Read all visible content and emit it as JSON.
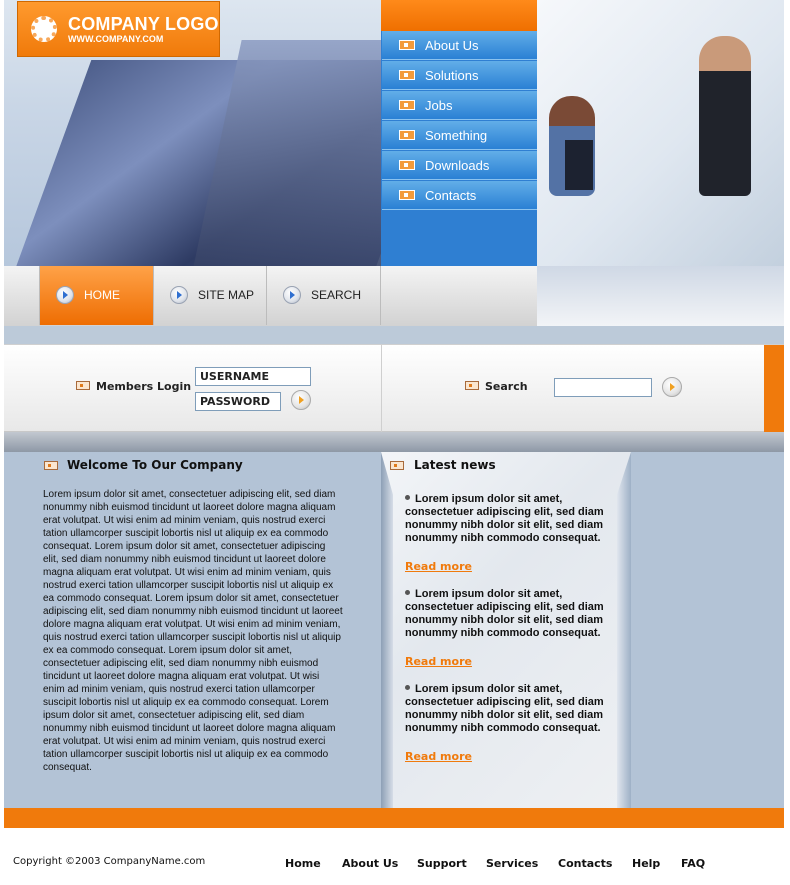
{
  "header": {
    "logo_title": "COMPANY LOGO",
    "logo_url": "WWW.COMPANY.COM"
  },
  "side_nav": [
    {
      "label": "About Us"
    },
    {
      "label": "Solutions"
    },
    {
      "label": "Jobs"
    },
    {
      "label": "Something"
    },
    {
      "label": "Downloads"
    },
    {
      "label": "Contacts"
    }
  ],
  "tabs": [
    {
      "label": "HOME",
      "active": true
    },
    {
      "label": "SITE MAP",
      "active": false
    },
    {
      "label": "SEARCH",
      "active": false
    }
  ],
  "login": {
    "label": "Members Login",
    "username_value": "USERNAME",
    "password_value": "PASSWORD"
  },
  "search": {
    "label": "Search",
    "value": ""
  },
  "welcome": {
    "title": "Welcome To Our Company",
    "body": "Lorem ipsum dolor sit amet, consectetuer adipiscing elit, sed diam nonummy nibh euismod tincidunt ut laoreet dolore magna aliquam erat volutpat. Ut wisi enim ad minim veniam, quis nostrud exerci tation ullamcorper suscipit lobortis nisl ut aliquip ex ea commodo consequat. Lorem ipsum dolor sit amet, consectetuer adipiscing elit, sed diam nonummy nibh euismod tincidunt ut laoreet dolore magna aliquam erat volutpat. Ut wisi enim ad minim veniam, quis nostrud exerci tation ullamcorper suscipit lobortis nisl ut aliquip ex ea commodo consequat. Lorem ipsum dolor sit amet, consectetuer adipiscing elit, sed diam nonummy nibh euismod tincidunt ut laoreet dolore magna aliquam erat volutpat. Ut wisi enim ad minim veniam, quis nostrud exerci tation ullamcorper suscipit lobortis nisl ut aliquip ex ea commodo consequat. Lorem ipsum dolor sit amet, consectetuer adipiscing elit, sed diam nonummy nibh euismod tincidunt ut laoreet dolore magna aliquam erat volutpat. Ut wisi enim ad minim veniam, quis nostrud exerci tation ullamcorper suscipit lobortis nisl ut aliquip ex ea commodo consequat. Lorem ipsum dolor sit amet, consectetuer adipiscing elit, sed diam nonummy nibh euismod tincidunt ut laoreet dolore magna aliquam erat volutpat. Ut wisi enim ad minim veniam, quis nostrud exerci tation ullamcorper suscipit lobortis nisl ut aliquip ex ea commodo consequat."
  },
  "news": {
    "title": "Latest news",
    "items": [
      {
        "text": "Lorem ipsum dolor sit amet, consectetuer adipiscing elit, sed diam nonummy nibh dolor sit elit, sed diam nonummy nibh commodo consequat.",
        "link": "Read more"
      },
      {
        "text": "Lorem ipsum dolor sit amet, consectetuer adipiscing elit, sed diam nonummy nibh dolor sit elit, sed diam nonummy nibh commodo consequat.",
        "link": "Read more"
      },
      {
        "text": "Lorem ipsum dolor sit amet, consectetuer adipiscing elit, sed diam nonummy nibh dolor sit elit, sed diam nonummy nibh commodo consequat.",
        "link": "Read more"
      }
    ]
  },
  "footer": {
    "copyright": "Copyright ©2003 CompanyName.com",
    "links": [
      "Home",
      "About Us",
      "Support",
      "Services",
      "Contacts",
      "Help",
      "FAQ"
    ]
  },
  "colors": {
    "accent_orange": "#f07a0c",
    "nav_blue": "#2f7fd2",
    "panel_blue_gray": "#b3c3d6"
  }
}
